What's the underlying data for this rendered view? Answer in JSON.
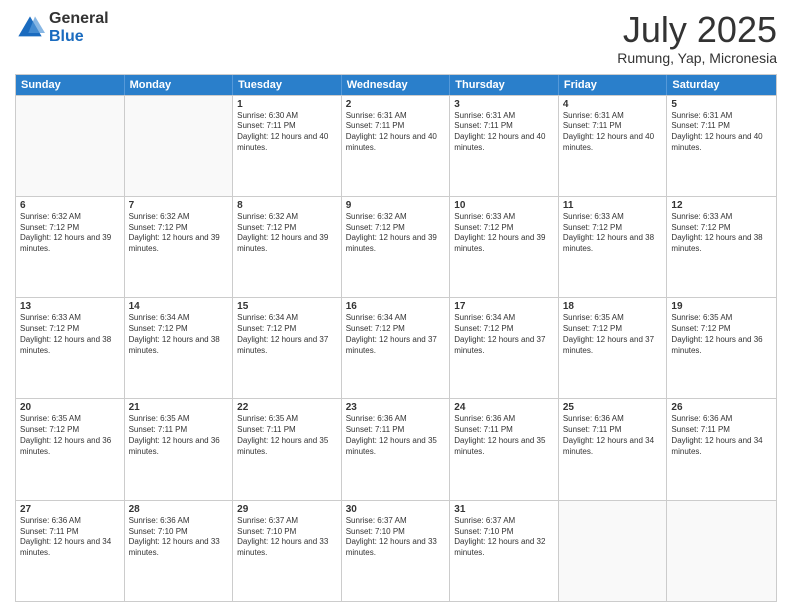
{
  "logo": {
    "general": "General",
    "blue": "Blue"
  },
  "title": "July 2025",
  "location": "Rumung, Yap, Micronesia",
  "header_days": [
    "Sunday",
    "Monday",
    "Tuesday",
    "Wednesday",
    "Thursday",
    "Friday",
    "Saturday"
  ],
  "rows": [
    [
      {
        "num": "",
        "info": ""
      },
      {
        "num": "",
        "info": ""
      },
      {
        "num": "1",
        "info": "Sunrise: 6:30 AM\nSunset: 7:11 PM\nDaylight: 12 hours and 40 minutes."
      },
      {
        "num": "2",
        "info": "Sunrise: 6:31 AM\nSunset: 7:11 PM\nDaylight: 12 hours and 40 minutes."
      },
      {
        "num": "3",
        "info": "Sunrise: 6:31 AM\nSunset: 7:11 PM\nDaylight: 12 hours and 40 minutes."
      },
      {
        "num": "4",
        "info": "Sunrise: 6:31 AM\nSunset: 7:11 PM\nDaylight: 12 hours and 40 minutes."
      },
      {
        "num": "5",
        "info": "Sunrise: 6:31 AM\nSunset: 7:11 PM\nDaylight: 12 hours and 40 minutes."
      }
    ],
    [
      {
        "num": "6",
        "info": "Sunrise: 6:32 AM\nSunset: 7:12 PM\nDaylight: 12 hours and 39 minutes."
      },
      {
        "num": "7",
        "info": "Sunrise: 6:32 AM\nSunset: 7:12 PM\nDaylight: 12 hours and 39 minutes."
      },
      {
        "num": "8",
        "info": "Sunrise: 6:32 AM\nSunset: 7:12 PM\nDaylight: 12 hours and 39 minutes."
      },
      {
        "num": "9",
        "info": "Sunrise: 6:32 AM\nSunset: 7:12 PM\nDaylight: 12 hours and 39 minutes."
      },
      {
        "num": "10",
        "info": "Sunrise: 6:33 AM\nSunset: 7:12 PM\nDaylight: 12 hours and 39 minutes."
      },
      {
        "num": "11",
        "info": "Sunrise: 6:33 AM\nSunset: 7:12 PM\nDaylight: 12 hours and 38 minutes."
      },
      {
        "num": "12",
        "info": "Sunrise: 6:33 AM\nSunset: 7:12 PM\nDaylight: 12 hours and 38 minutes."
      }
    ],
    [
      {
        "num": "13",
        "info": "Sunrise: 6:33 AM\nSunset: 7:12 PM\nDaylight: 12 hours and 38 minutes."
      },
      {
        "num": "14",
        "info": "Sunrise: 6:34 AM\nSunset: 7:12 PM\nDaylight: 12 hours and 38 minutes."
      },
      {
        "num": "15",
        "info": "Sunrise: 6:34 AM\nSunset: 7:12 PM\nDaylight: 12 hours and 37 minutes."
      },
      {
        "num": "16",
        "info": "Sunrise: 6:34 AM\nSunset: 7:12 PM\nDaylight: 12 hours and 37 minutes."
      },
      {
        "num": "17",
        "info": "Sunrise: 6:34 AM\nSunset: 7:12 PM\nDaylight: 12 hours and 37 minutes."
      },
      {
        "num": "18",
        "info": "Sunrise: 6:35 AM\nSunset: 7:12 PM\nDaylight: 12 hours and 37 minutes."
      },
      {
        "num": "19",
        "info": "Sunrise: 6:35 AM\nSunset: 7:12 PM\nDaylight: 12 hours and 36 minutes."
      }
    ],
    [
      {
        "num": "20",
        "info": "Sunrise: 6:35 AM\nSunset: 7:12 PM\nDaylight: 12 hours and 36 minutes."
      },
      {
        "num": "21",
        "info": "Sunrise: 6:35 AM\nSunset: 7:11 PM\nDaylight: 12 hours and 36 minutes."
      },
      {
        "num": "22",
        "info": "Sunrise: 6:35 AM\nSunset: 7:11 PM\nDaylight: 12 hours and 35 minutes."
      },
      {
        "num": "23",
        "info": "Sunrise: 6:36 AM\nSunset: 7:11 PM\nDaylight: 12 hours and 35 minutes."
      },
      {
        "num": "24",
        "info": "Sunrise: 6:36 AM\nSunset: 7:11 PM\nDaylight: 12 hours and 35 minutes."
      },
      {
        "num": "25",
        "info": "Sunrise: 6:36 AM\nSunset: 7:11 PM\nDaylight: 12 hours and 34 minutes."
      },
      {
        "num": "26",
        "info": "Sunrise: 6:36 AM\nSunset: 7:11 PM\nDaylight: 12 hours and 34 minutes."
      }
    ],
    [
      {
        "num": "27",
        "info": "Sunrise: 6:36 AM\nSunset: 7:11 PM\nDaylight: 12 hours and 34 minutes."
      },
      {
        "num": "28",
        "info": "Sunrise: 6:36 AM\nSunset: 7:10 PM\nDaylight: 12 hours and 33 minutes."
      },
      {
        "num": "29",
        "info": "Sunrise: 6:37 AM\nSunset: 7:10 PM\nDaylight: 12 hours and 33 minutes."
      },
      {
        "num": "30",
        "info": "Sunrise: 6:37 AM\nSunset: 7:10 PM\nDaylight: 12 hours and 33 minutes."
      },
      {
        "num": "31",
        "info": "Sunrise: 6:37 AM\nSunset: 7:10 PM\nDaylight: 12 hours and 32 minutes."
      },
      {
        "num": "",
        "info": ""
      },
      {
        "num": "",
        "info": ""
      }
    ]
  ]
}
